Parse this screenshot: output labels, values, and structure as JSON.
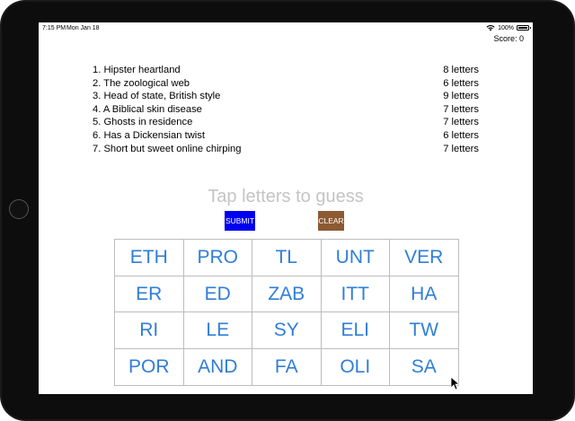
{
  "status_bar": {
    "time": "7:15 PM",
    "date": "Mon Jan 18",
    "battery": "100%",
    "icons": [
      "wifi-icon",
      "battery-icon"
    ]
  },
  "score": "Score: 0",
  "clues": [
    {
      "text": "1. Hipster heartland",
      "length": "8 letters"
    },
    {
      "text": "2. The zoological web",
      "length": "6 letters"
    },
    {
      "text": "3. Head of state, British style",
      "length": "9 letters"
    },
    {
      "text": "4. A Biblical skin disease",
      "length": "7 letters"
    },
    {
      "text": "5. Ghosts in residence",
      "length": "7 letters"
    },
    {
      "text": "6. Has a Dickensian twist",
      "length": "6 letters"
    },
    {
      "text": "7. Short but sweet online chirping",
      "length": "7 letters"
    }
  ],
  "prompt": "Tap letters to guess",
  "buttons": {
    "submit": "SUBMIT",
    "clear": "CLEAR"
  },
  "tiles": [
    "ETH",
    "PRO",
    "TL",
    "UNT",
    "VER",
    "ER",
    "ED",
    "ZAB",
    "ITT",
    "HA",
    "RI",
    "LE",
    "SY",
    "ELI",
    "TW",
    "POR",
    "AND",
    "FA",
    "OLI",
    "SA"
  ],
  "colors": {
    "submit_bg": "#0000f0",
    "clear_bg": "#8c5a33",
    "tile_text": "#2f7ed8",
    "prompt_text": "#c4c4c4"
  }
}
